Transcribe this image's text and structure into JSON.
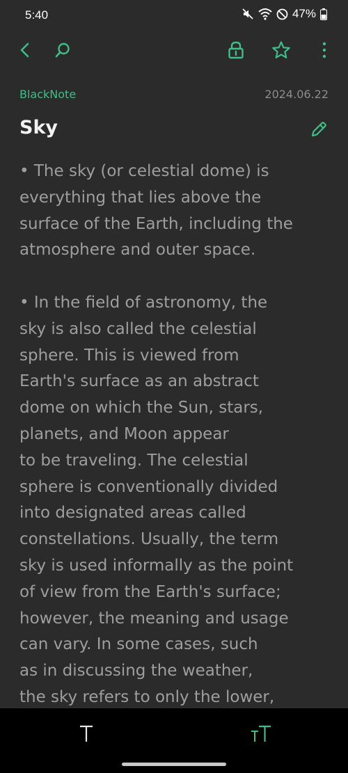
{
  "status_bar": {
    "time": "5:40",
    "battery": "47%",
    "icons": [
      "mute-icon",
      "wifi-icon",
      "do-not-disturb-icon",
      "battery-icon"
    ]
  },
  "toolbar": {
    "back_icon": "chevron-left-icon",
    "search_icon": "search-icon",
    "lock_icon": "lock-icon",
    "favorite_icon": "star-icon",
    "more_icon": "more-vertical-icon",
    "accent_color": "#3dbf8a"
  },
  "note": {
    "folder": "BlackNote",
    "date": "2024.06.22",
    "title": "Sky",
    "edit_icon": "pencil-icon",
    "paragraphs": [
      "• The sky (or celestial dome) is\neverything that lies above the\nsurface of the Earth, including the\natmosphere and outer space.",
      "• In the field of astronomy, the\nsky is also called the celestial\nsphere. This is viewed from\nEarth's surface as an abstract\ndome on which the Sun, stars,\nplanets, and Moon appear\nto be traveling. The celestial\nsphere is conventionally divided\ninto designated areas called\nconstellations. Usually, the term\nsky is used informally as the point\nof view from the Earth's surface;\nhowever, the meaning and usage\ncan vary. In some cases, such\nas in discussing the weather,\nthe sky refers to only the lower,"
    ]
  },
  "bottom_bar": {
    "text_style_label": "T",
    "text_size_label": "тT",
    "text_style_color": "#e6e6e6",
    "text_size_color": "#3dbf8a"
  }
}
